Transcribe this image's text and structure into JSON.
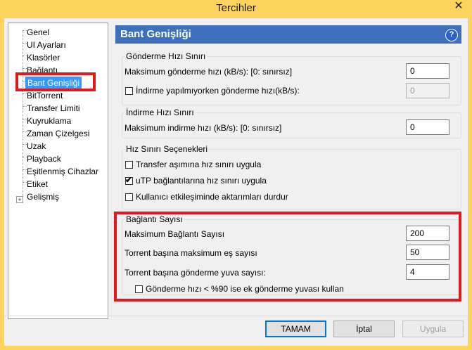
{
  "window": {
    "title": "Tercihler",
    "close": "✕"
  },
  "sidebar": {
    "items": [
      {
        "label": "Genel"
      },
      {
        "label": "UI Ayarları"
      },
      {
        "label": "Klasörler"
      },
      {
        "label": "Bağlantı"
      },
      {
        "label": "Bant Genişliği",
        "selected": true
      },
      {
        "label": "BitTorrent"
      },
      {
        "label": "Transfer Limiti"
      },
      {
        "label": "Kuyruklama"
      },
      {
        "label": "Zaman Çizelgesi"
      },
      {
        "label": "Uzak"
      },
      {
        "label": "Playback"
      },
      {
        "label": "Eşitlenmiş Cihazlar"
      },
      {
        "label": "Etiket"
      },
      {
        "label": "Gelişmiş"
      }
    ],
    "expander": "+"
  },
  "panel": {
    "title": "Bant Genişliği",
    "help": "?",
    "upload": {
      "legend": "Gönderme Hızı Sınırı",
      "max_label": "Maksimum gönderme hızı (kB/s): [0: sınırsız]",
      "max_value": "0",
      "alt_label": "İndirme yapılmıyorken gönderme hızı(kB/s):",
      "alt_checked": false,
      "alt_value": "0"
    },
    "download": {
      "legend": "İndirme Hızı Sınırı",
      "max_label": "Maksimum indirme hızı (kB/s): [0: sınırsız]",
      "max_value": "0"
    },
    "options": {
      "legend": "Hız Sınırı Seçenekleri",
      "items": [
        {
          "label": "Transfer aşımına hız sınırı uygula",
          "checked": false
        },
        {
          "label": "uTP bağlantılarına hız sınırı uygula",
          "checked": true
        },
        {
          "label": "Kullanıcı etkileşiminde aktarımları durdur",
          "checked": false
        }
      ]
    },
    "connections": {
      "legend": "Bağlantı Sayısı",
      "max_conn_label": "Maksimum Bağlantı Sayısı",
      "max_conn_value": "200",
      "peers_label": "Torrent başına maksimum eş sayısı",
      "peers_value": "50",
      "slots_label": "Torrent başına gönderme yuva sayısı:",
      "slots_value": "4",
      "extra_label": "Gönderme hızı < %90 ise ek gönderme yuvası kullan",
      "extra_checked": false
    }
  },
  "buttons": {
    "ok": "TAMAM",
    "cancel": "İptal",
    "apply": "Uygula"
  },
  "check_glyph": "✔"
}
